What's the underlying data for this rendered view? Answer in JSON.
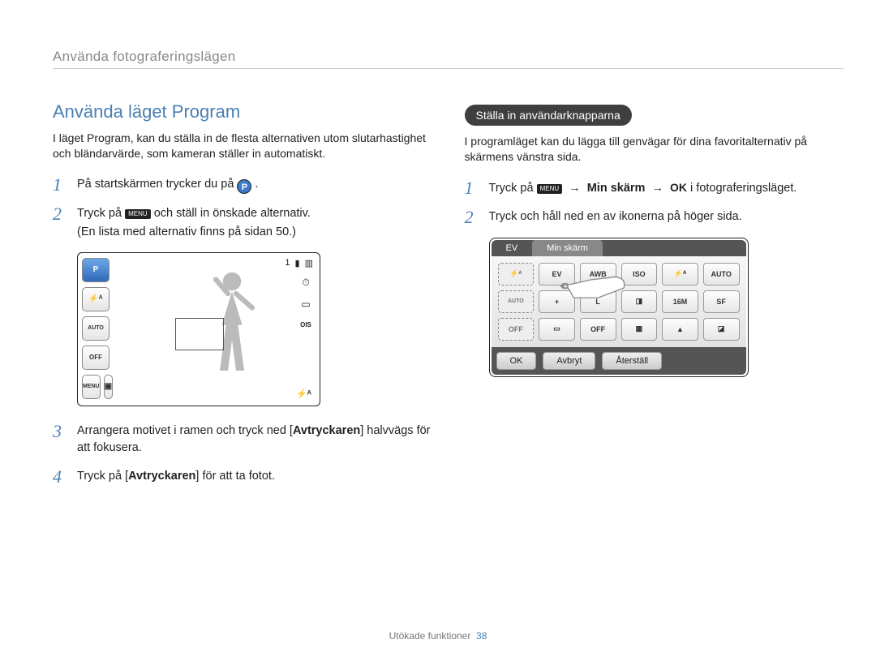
{
  "header": {
    "section": "Använda fotograferingslägen"
  },
  "left": {
    "title": "Använda läget Program",
    "intro": "I läget Program, kan du ställa in de flesta alternativen utom slutarhastighet och bländarvärde, som kameran ställer in automatiskt.",
    "steps": [
      {
        "num": "1",
        "text_a": "På startskärmen trycker du på ",
        "text_b": "."
      },
      {
        "num": "2",
        "text_a": "Tryck på ",
        "text_b": " och ställ in önskade alternativ.",
        "sub": "(En lista med alternativ finns på sidan 50.)"
      },
      {
        "num": "3",
        "text_a": "Arrangera motivet i ramen och tryck ned [",
        "bold": "Avtryckaren",
        "text_b": "] halvvägs för att fokusera."
      },
      {
        "num": "4",
        "text_a": "Tryck på [",
        "bold": "Avtryckaren",
        "text_b": "] för att ta fotot."
      }
    ],
    "camera_fig": {
      "mode": "P",
      "left_icons": [
        "⚡ᴬ",
        "AUTO",
        "OFF",
        "MENU"
      ],
      "topright_count": "1",
      "right_icons": [
        "⏱",
        "▭",
        "OIS"
      ],
      "bottom_right": "⚡ᴬ"
    }
  },
  "right": {
    "pill": "Ställa in användarknapparna",
    "intro": "I programläget kan du lägga till genvägar för dina favoritalternativ på skärmens vänstra sida.",
    "steps": [
      {
        "num": "1",
        "text_a": "Tryck på ",
        "mid": " → ",
        "bold": "Min skärm",
        "mid2": " → ",
        "text_b": " i fotograferingsläget."
      },
      {
        "num": "2",
        "text_a": "Tryck och håll ned en av ikonerna på höger sida."
      }
    ],
    "grid_fig": {
      "tabs": [
        "EV",
        "Min skärm"
      ],
      "slots_dashed": [
        "⚡ᴬ",
        "AUTO",
        "OFF"
      ],
      "icons_row1": [
        "EV",
        "AWB",
        "ISO",
        "⚡ᴬ",
        "AUTO"
      ],
      "icons_row2": [
        "+",
        "L",
        "◨",
        "16M",
        "SF"
      ],
      "icons_row3": [
        "▭",
        "OFF",
        "▦",
        "▲",
        "◪"
      ],
      "buttons": [
        "OK",
        "Avbryt",
        "Återställ"
      ]
    }
  },
  "icons": {
    "menu_label": "MENU",
    "ok_label": "OK",
    "p_label": "P"
  },
  "footer": {
    "label": "Utökade funktioner",
    "page": "38"
  }
}
